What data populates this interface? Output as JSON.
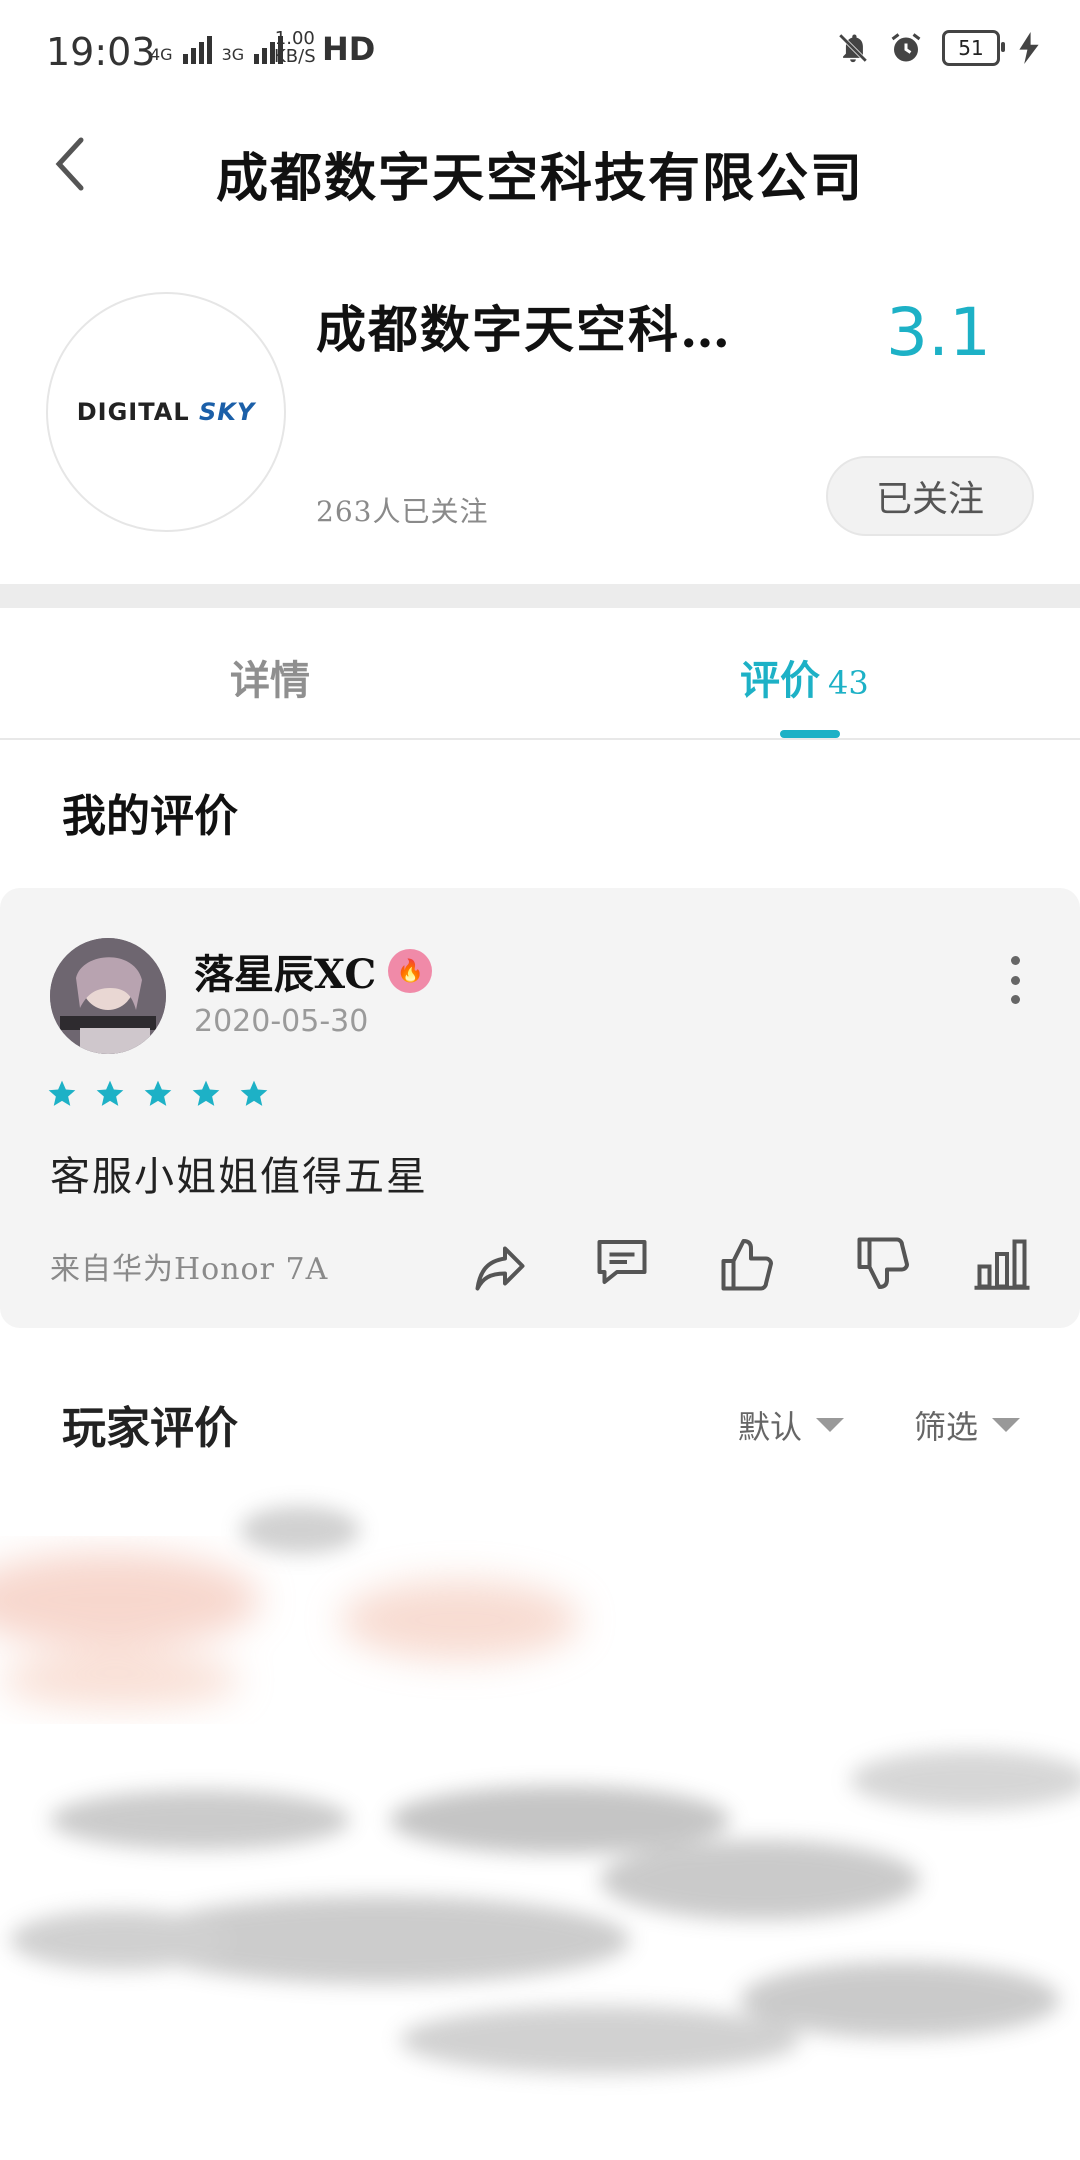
{
  "status_bar": {
    "time": "19:03",
    "network_4g": "4G",
    "network_3g": "3G",
    "speed_value": "1.00",
    "speed_unit": "KB/S",
    "hd": "HD",
    "battery": "51"
  },
  "header": {
    "title": "成都数字天空科技有限公司"
  },
  "profile": {
    "logo_text_left": "DIGITAL",
    "logo_text_right": "SKY",
    "name": "成都数字天空科…",
    "score": "3.1",
    "followers": "263人已关注",
    "follow_button": "已关注"
  },
  "tabs": {
    "details": "详情",
    "reviews": "评价",
    "reviews_count": "43"
  },
  "my_review": {
    "section_title": "我的评价",
    "username": "落星辰XC",
    "date": "2020-05-30",
    "rating": 5,
    "text": "客服小姐姐值得五星",
    "device": "来自华为Honor 7A"
  },
  "player_reviews": {
    "section_title": "玩家评价",
    "sort_label": "默认",
    "filter_label": "筛选"
  },
  "colors": {
    "accent": "#1db1c6",
    "card_bg": "#f4f4f4",
    "muted": "#8a8a8a"
  },
  "icons": {
    "back": "chevron-left-icon",
    "mute": "bell-off-icon",
    "alarm": "alarm-icon",
    "charging": "bolt-icon",
    "share": "share-icon",
    "comment": "comment-icon",
    "like": "thumbs-up-icon",
    "dislike": "thumbs-down-icon",
    "stats": "bar-chart-icon",
    "more": "more-vertical-icon"
  }
}
